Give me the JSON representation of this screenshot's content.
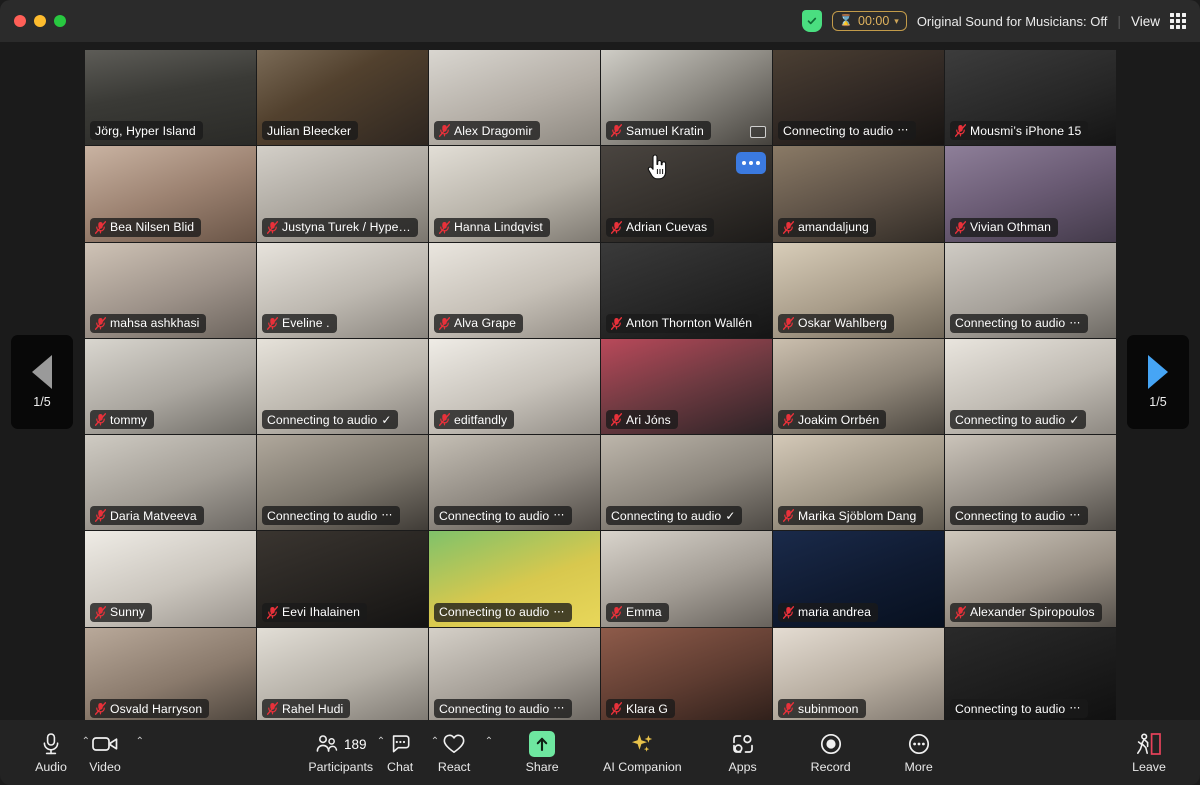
{
  "window": {
    "traffic_lights": [
      "close",
      "minimize",
      "maximize"
    ]
  },
  "titlebar": {
    "encryption_icon": "shield-check-icon",
    "timer_icon": "hourglass-icon",
    "timer_value": "00:00",
    "timer_caret": "⌄",
    "original_sound_label": "Original Sound for Musicians: Off",
    "separator": "|",
    "view_label": "View",
    "view_icon": "grid-view-icon",
    "accent_timer": "#e0b35e",
    "accent_shield": "#4ade80"
  },
  "pager": {
    "prev_icon": "triangle-left-icon",
    "next_icon": "triangle-right-icon",
    "prev_label": "1/5",
    "next_label": "1/5",
    "prev_color": "#9a9a9a",
    "next_color": "#46a5f5"
  },
  "grid": {
    "columns": 6,
    "rows": 7,
    "active_border_color": "#27c840",
    "hover_tile_index": 9,
    "tiles": [
      {
        "name": "Jörg, Hyper Island",
        "muted": false,
        "connecting": false,
        "active": true,
        "bg": "linear-gradient(170deg,#5d5c57 0%,#3a3a36 45%,#2a2a27 100%)"
      },
      {
        "name": "Julian Bleecker",
        "muted": false,
        "connecting": false,
        "bg": "linear-gradient(150deg,#7a6a56 0%,#52412e 40%,#2e2620 100%)"
      },
      {
        "name": "Alex Dragomir",
        "muted": true,
        "connecting": false,
        "bg": "linear-gradient(160deg,#d9d6d0 0%,#b4aea6 55%,#8d8880 100%)"
      },
      {
        "name": "Samuel Kratin",
        "muted": true,
        "connecting": false,
        "screenshare": true,
        "bg": "linear-gradient(150deg,#cfcdc6 0%,#8e8b84 50%,#45423d 100%)"
      },
      {
        "name": "Connecting to audio",
        "muted": false,
        "connecting": true,
        "trailing": "dots",
        "bg": "linear-gradient(160deg,#4b3f33 0%,#2f2723 55%,#171412 100%)"
      },
      {
        "name": "Mousmi’s iPhone 15",
        "muted": true,
        "connecting": false,
        "bg": "linear-gradient(160deg,#3c3c3c 0%,#262626 60%,#141414 100%)"
      },
      {
        "name": "Bea Nilsen Blid",
        "muted": true,
        "connecting": false,
        "bg": "linear-gradient(160deg,#c9b3a2 0%,#9d8372 50%,#6a5547 100%)"
      },
      {
        "name": "Justyna Turek / Hype…",
        "muted": true,
        "connecting": false,
        "bg": "linear-gradient(160deg,#d3cfc8 0%,#a9a49c 55%,#7b766e 100%)"
      },
      {
        "name": "Hanna Lindqvist",
        "muted": true,
        "connecting": false,
        "bg": "linear-gradient(160deg,#e2ded6 0%,#b8b3a9 55%,#7f7a72 100%)"
      },
      {
        "name": "Adrian Cuevas",
        "muted": true,
        "connecting": false,
        "hover": true,
        "bg": "linear-gradient(160deg,#4a4540 0%,#332f2b 55%,#1d1b19 100%)"
      },
      {
        "name": "amandaljung",
        "muted": true,
        "connecting": false,
        "bg": "linear-gradient(160deg,#8a7a66 0%,#5c5045 55%,#322c26 100%)"
      },
      {
        "name": "Vivian Othman",
        "muted": true,
        "connecting": false,
        "bg": "linear-gradient(160deg,#8e7f99 0%,#6a5b74 50%,#433a4a 100%)"
      },
      {
        "name": "mahsa ashkhasi",
        "muted": true,
        "connecting": false,
        "bg": "linear-gradient(160deg,#cfc3b6 0%,#9d9289 55%,#6c645d 100%)"
      },
      {
        "name": "Eveline .",
        "muted": true,
        "connecting": false,
        "bg": "linear-gradient(160deg,#e7e3dc 0%,#bdb8b0 55%,#8b867f 100%)"
      },
      {
        "name": "Alva Grape",
        "muted": true,
        "connecting": false,
        "bg": "linear-gradient(160deg,#eae6df 0%,#c6c0b7 55%,#948e86 100%)"
      },
      {
        "name": "Anton Thornton Wallén",
        "muted": true,
        "connecting": false,
        "bg": "linear-gradient(160deg,#3a3a3a 0%,#262626 55%,#151515 100%)"
      },
      {
        "name": "Oskar Wahlberg",
        "muted": true,
        "connecting": false,
        "bg": "linear-gradient(160deg,#d8cdb9 0%,#a89c89 55%,#6f6658 100%)"
      },
      {
        "name": "Connecting to audio",
        "muted": false,
        "connecting": true,
        "trailing": "dots",
        "bg": "linear-gradient(160deg,#cfcbc4 0%,#a5a099 55%,#6e6a64 100%)"
      },
      {
        "name": "tommy",
        "muted": true,
        "connecting": false,
        "bg": "linear-gradient(160deg,#d9d6cf 0%,#aaa69f 55%,#6f6c66 100%)"
      },
      {
        "name": "Connecting to audio",
        "muted": false,
        "connecting": true,
        "trailing": "check",
        "bg": "linear-gradient(160deg,#e6e2da 0%,#bbb6ad 55%,#85807a 100%)"
      },
      {
        "name": "editfandly",
        "muted": true,
        "connecting": false,
        "bg": "linear-gradient(160deg,#efece6 0%,#c7c2ba 55%,#938e87 100%)"
      },
      {
        "name": "Ari Jóns",
        "muted": true,
        "connecting": false,
        "bg": "linear-gradient(160deg,#b9495a 0%,#6e3a41 50%,#2d2326 100%)"
      },
      {
        "name": "Joakim Orrbén",
        "muted": true,
        "connecting": false,
        "bg": "linear-gradient(160deg,#cbbfae 0%,#8e8578 55%,#4a453e 100%)"
      },
      {
        "name": "Connecting to audio",
        "muted": false,
        "connecting": true,
        "trailing": "check",
        "bg": "linear-gradient(160deg,#e9e5de 0%,#c0bbb3 55%,#8d8881 100%)"
      },
      {
        "name": "Daria Matveeva",
        "muted": true,
        "connecting": false,
        "bg": "linear-gradient(160deg,#cfcbc3 0%,#a29d95 55%,#6b6762 100%)"
      },
      {
        "name": "Connecting to audio",
        "muted": false,
        "connecting": true,
        "trailing": "dots",
        "bg": "linear-gradient(160deg,#b0a89c 0%,#7c766c 55%,#403c37 100%)"
      },
      {
        "name": "Connecting to audio",
        "muted": false,
        "connecting": true,
        "trailing": "dots",
        "bg": "linear-gradient(160deg,#c5bfb5 0%,#8e8880 55%,#504b46 100%)"
      },
      {
        "name": "Connecting to audio",
        "muted": false,
        "connecting": true,
        "trailing": "check",
        "bg": "linear-gradient(160deg,#bdb6ab 0%,#8a847b 55%,#4e4a45 100%)"
      },
      {
        "name": "Marika Sjöblom Dang",
        "muted": true,
        "connecting": false,
        "bg": "linear-gradient(160deg,#d4c9b8 0%,#9d9484 55%,#5f594f 100%)"
      },
      {
        "name": "Connecting to audio",
        "muted": false,
        "connecting": true,
        "trailing": "dots",
        "bg": "linear-gradient(160deg,#cbc4ba 0%,#8f8981 55%,#4f4b46 100%)"
      },
      {
        "name": "Sunny",
        "muted": true,
        "connecting": false,
        "bg": "linear-gradient(160deg,#efece6 0%,#cac5bd 55%,#9a948d 100%)"
      },
      {
        "name": "Eevi Ihalainen",
        "muted": true,
        "connecting": false,
        "bg": "linear-gradient(160deg,#3a3530 0%,#262320 55%,#141312 100%)"
      },
      {
        "name": "Connecting to audio",
        "muted": false,
        "connecting": true,
        "trailing": "dots",
        "bg": "linear-gradient(160deg,#7fc26a 0%,#d8c84e 55%,#e8d75a 100%)"
      },
      {
        "name": "Emma",
        "muted": true,
        "connecting": false,
        "bg": "linear-gradient(160deg,#d9d4cc 0%,#a29c94 55%,#67625c 100%)"
      },
      {
        "name": "maria andrea",
        "muted": true,
        "connecting": false,
        "bg": "linear-gradient(160deg,#1a2a4a 0%,#0f1a30 55%,#07101f 100%)"
      },
      {
        "name": "Alexander Spiropoulos",
        "muted": true,
        "connecting": false,
        "bg": "linear-gradient(160deg,#cfc8bd 0%,#988f84 55%,#55504a 100%)"
      },
      {
        "name": "Osvald Harryson",
        "muted": true,
        "connecting": false,
        "bg": "linear-gradient(160deg,#b9a99a 0%,#8a7a6c 55%,#4c443c 100%)"
      },
      {
        "name": "Rahel Hudi",
        "muted": true,
        "connecting": false,
        "bg": "linear-gradient(160deg,#e2ded6 0%,#b5b0a7 55%,#7d7871 100%)"
      },
      {
        "name": "Connecting to audio",
        "muted": false,
        "connecting": true,
        "trailing": "dots",
        "bg": "linear-gradient(160deg,#d5d0c8 0%,#a49e96 55%,#6a655f 100%)"
      },
      {
        "name": "Klara G",
        "muted": true,
        "connecting": false,
        "bg": "linear-gradient(160deg,#8e5b4a 0%,#5e3c31 55%,#2e1f1a 100%)"
      },
      {
        "name": "subinmoon",
        "muted": true,
        "connecting": false,
        "bg": "linear-gradient(160deg,#e4dcd2 0%,#b6ac9f 55%,#7d756c 100%)"
      },
      {
        "name": "Connecting to audio",
        "muted": false,
        "connecting": true,
        "trailing": "dots",
        "bg": "linear-gradient(160deg,#2a2a2a 0%,#1c1c1c 55%,#101010 100%)"
      }
    ]
  },
  "toolbar": {
    "items": [
      {
        "label": "Audio",
        "icon": "microphone-icon",
        "caret": true
      },
      {
        "label": "Video",
        "icon": "camera-icon",
        "caret": true
      },
      {
        "label": "Participants",
        "icon": "participants-icon",
        "caret": true,
        "count": "189"
      },
      {
        "label": "Chat",
        "icon": "chat-bubble-icon",
        "caret": true
      },
      {
        "label": "React",
        "icon": "heart-icon",
        "caret": true
      },
      {
        "label": "Share",
        "icon": "share-screen-icon",
        "caret": false
      },
      {
        "label": "AI Companion",
        "icon": "sparkles-icon",
        "caret": false
      },
      {
        "label": "Apps",
        "icon": "apps-icon",
        "caret": false
      },
      {
        "label": "Record",
        "icon": "record-icon",
        "caret": false
      },
      {
        "label": "More",
        "icon": "ellipsis-icon",
        "caret": false
      },
      {
        "label": "Leave",
        "icon": "leave-door-icon",
        "caret": false
      }
    ],
    "share_accent": "#6ee7a0",
    "ai_accent": "#e8c24a",
    "leave_accent": "#e8425a"
  }
}
